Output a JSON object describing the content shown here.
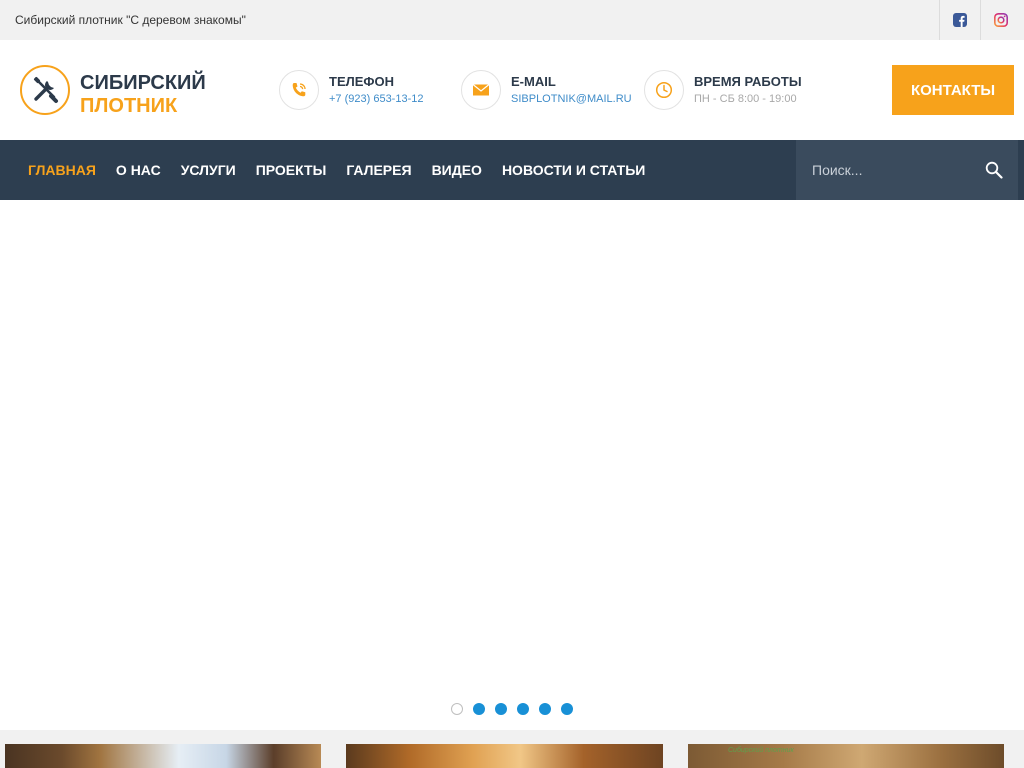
{
  "topbar": {
    "tagline": "Сибирский плотник \"С деревом знакомы\"",
    "social": [
      {
        "icon": "facebook-icon"
      },
      {
        "icon": "instagram-icon"
      }
    ]
  },
  "header": {
    "logo": {
      "line1": "СИБИРСКИЙ",
      "line2": "ПЛОТНИК",
      "icon": "tools-icon"
    },
    "phone": {
      "title": "ТЕЛЕФОН",
      "value": "+7 (923) 653-13-12",
      "icon": "phone-icon"
    },
    "email": {
      "title": "E-MAIL",
      "value": "SIBPLOTNIK@MAIL.RU",
      "icon": "envelope-icon"
    },
    "hours": {
      "title": "ВРЕМЯ РАБОТЫ",
      "value": "ПН - СБ 8:00 - 19:00",
      "icon": "clock-icon"
    },
    "contacts_button": "КОНТАКТЫ"
  },
  "nav": {
    "items": [
      {
        "label": "ГЛАВНАЯ",
        "active": true
      },
      {
        "label": "О НАС"
      },
      {
        "label": "УСЛУГИ"
      },
      {
        "label": "ПРОЕКТЫ"
      },
      {
        "label": "ГАЛЕРЕЯ"
      },
      {
        "label": "ВИДЕО"
      },
      {
        "label": "НОВОСТИ И СТАТЬИ"
      }
    ],
    "search_placeholder": "Поиск...",
    "search_icon": "search-icon"
  },
  "slider": {
    "slide_count": 6,
    "active_index": 0
  },
  "cards": {
    "card3_label": "Сибирский плотник"
  },
  "colors": {
    "accent": "#f7a21b",
    "nav_bg": "#2d3e50",
    "link": "#3f8cc9",
    "dot": "#1890d6"
  }
}
